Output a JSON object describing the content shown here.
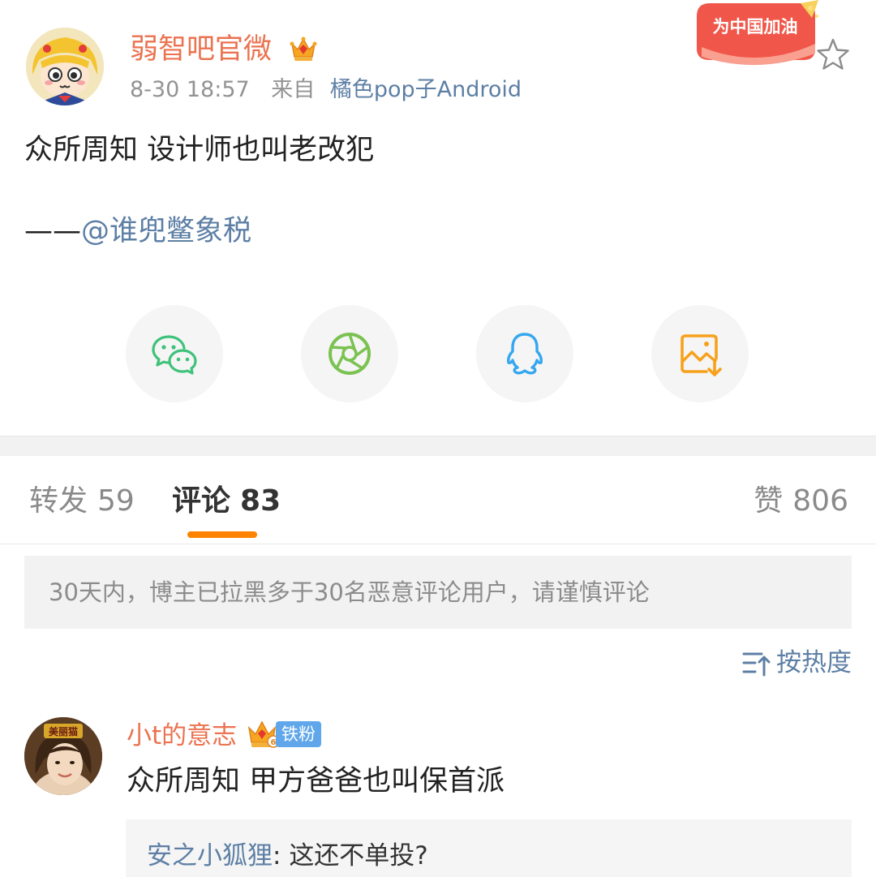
{
  "post": {
    "author": "弱智吧官微",
    "time": "8-30 18:57",
    "source_prefix": "来自",
    "source": "橘色pop子Android",
    "text": "众所周知 设计师也叫老改犯",
    "attribution_dash": "——",
    "attribution_mention": "@谁兜鳖象税",
    "promo_badge_text": "为中国加油"
  },
  "share": [
    {
      "name": "wechat",
      "icon": "wechat-icon",
      "color": "#3fc27a"
    },
    {
      "name": "moments",
      "icon": "moments-aperture-icon",
      "color": "#7ac251"
    },
    {
      "name": "qq",
      "icon": "qq-penguin-icon",
      "color": "#34a7f0"
    },
    {
      "name": "save-image",
      "icon": "save-image-icon",
      "color": "#f7a11b"
    }
  ],
  "tabs": {
    "repost_label": "转发",
    "repost_count": "59",
    "comments_label": "评论",
    "comments_count": "83",
    "likes_label": "赞",
    "likes_count": "806"
  },
  "notice": "30天内，博主已拉黑多于30名恶意评论用户，请谨慎评论",
  "sort_label": "按热度",
  "comments": [
    {
      "user": "小t的意志",
      "fan_badge": "铁粉",
      "crown_level": "6",
      "text": "众所周知 甲方爸爸也叫保首派",
      "avatar_caption": "美丽猫",
      "reply": {
        "user": "安之小狐狸",
        "separator": ": ",
        "text": "这还不单投?"
      }
    }
  ],
  "colors": {
    "accent_orange": "#ff8200",
    "username_orange": "#eb7350",
    "link_blue": "#5d7fa5",
    "fan_badge_blue": "#5fa7ea"
  }
}
